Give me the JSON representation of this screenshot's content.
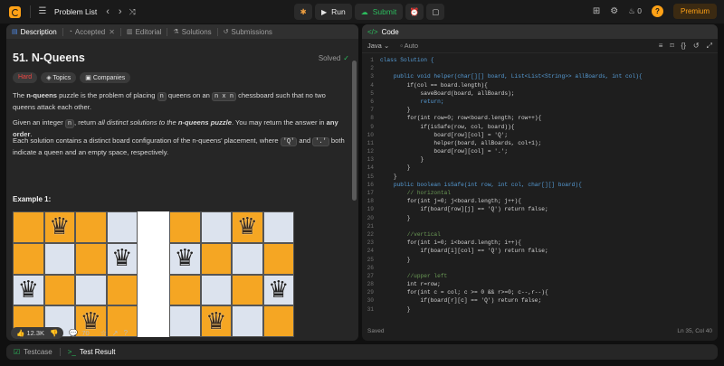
{
  "topbar": {
    "problem_list": "Problem List",
    "run": "Run",
    "submit": "Submit",
    "streak_count": "0",
    "premium": "Premium"
  },
  "left_tabs": [
    {
      "label": "Description",
      "icon": "description-icon",
      "active": true
    },
    {
      "label": "Accepted",
      "icon": "clock-icon",
      "active": false
    },
    {
      "label": "Editorial",
      "icon": "book-icon",
      "active": false
    },
    {
      "label": "Solutions",
      "icon": "flask-icon",
      "active": false
    },
    {
      "label": "Submissions",
      "icon": "history-icon",
      "active": false
    }
  ],
  "problem": {
    "title": "51. N-Queens",
    "status": "Solved",
    "difficulty": "Hard",
    "topics_label": "Topics",
    "companies_label": "Companies",
    "p1_a": "The ",
    "p1_b": "n-queens",
    "p1_c": " puzzle is the problem of placing ",
    "p1_d": "n",
    "p1_e": " queens on an ",
    "p1_f": "n x n",
    "p1_g": " chessboard such that no two queens attack each other.",
    "p2_a": "Given an integer ",
    "p2_b": "n",
    "p2_c": ", return ",
    "p2_d": "all distinct solutions to the ",
    "p2_e": "n-queens puzzle",
    "p2_f": ". You may return the answer in ",
    "p2_g": "any order",
    "p2_h": ".",
    "p3_a": "Each solution contains a distinct board configuration of the n-queens' placement, where ",
    "p3_b": "'Q'",
    "p3_c": " and ",
    "p3_d": "'.'",
    "p3_e": " both indicate a queen and an empty space, respectively.",
    "example_title": "Example 1:"
  },
  "boards": [
    {
      "colors": [
        "o",
        "o",
        "o",
        "b",
        "o",
        "b",
        "o",
        "b",
        "b",
        "o",
        "b",
        "o",
        "o",
        "b",
        "o",
        "o"
      ],
      "queens": [
        1,
        7,
        8,
        14
      ]
    },
    {
      "colors": [
        "o",
        "b",
        "o",
        "b",
        "b",
        "o",
        "b",
        "o",
        "o",
        "b",
        "o",
        "b",
        "b",
        "o",
        "b",
        "o"
      ],
      "queens": [
        2,
        4,
        11,
        13
      ]
    }
  ],
  "bottom_bar": {
    "likes": "12.3K",
    "comments": "70"
  },
  "code_panel": {
    "title": "Code",
    "language": "Java",
    "autocomplete": "Auto",
    "status": "Saved",
    "cursor": "Ln 35, Col 40"
  },
  "code_lines": [
    {
      "n": "1",
      "t": "class Solution {",
      "c": "kw"
    },
    {
      "n": "2",
      "t": "",
      "c": ""
    },
    {
      "n": "3",
      "t": "    public void helper(char[][] board, List<List<String>> allBoards, int col){",
      "c": "kw"
    },
    {
      "n": "4",
      "t": "        if(col == board.length){",
      "c": ""
    },
    {
      "n": "5",
      "t": "            saveBoard(board, allBoards);",
      "c": ""
    },
    {
      "n": "6",
      "t": "            return;",
      "c": "kw"
    },
    {
      "n": "7",
      "t": "        }",
      "c": ""
    },
    {
      "n": "8",
      "t": "        for(int row=0; row<board.length; row++){",
      "c": ""
    },
    {
      "n": "9",
      "t": "            if(isSafe(row, col, board)){",
      "c": ""
    },
    {
      "n": "10",
      "t": "                board[row][col] = 'Q';",
      "c": ""
    },
    {
      "n": "11",
      "t": "                helper(board, allBoards, col+1);",
      "c": ""
    },
    {
      "n": "12",
      "t": "                board[row][col] = '.';",
      "c": ""
    },
    {
      "n": "13",
      "t": "            }",
      "c": ""
    },
    {
      "n": "14",
      "t": "        }",
      "c": ""
    },
    {
      "n": "15",
      "t": "    }",
      "c": ""
    },
    {
      "n": "16",
      "t": "    public boolean isSafe(int row, int col, char[][] board){",
      "c": "kw"
    },
    {
      "n": "17",
      "t": "        // horizontal",
      "c": "cm"
    },
    {
      "n": "18",
      "t": "        for(int j=0; j<board.length; j++){",
      "c": ""
    },
    {
      "n": "19",
      "t": "            if(board[row][j] == 'Q') return false;",
      "c": ""
    },
    {
      "n": "20",
      "t": "        }",
      "c": ""
    },
    {
      "n": "21",
      "t": "",
      "c": ""
    },
    {
      "n": "22",
      "t": "        //vertical",
      "c": "cm"
    },
    {
      "n": "23",
      "t": "        for(int i=0; i<board.length; i++){",
      "c": ""
    },
    {
      "n": "24",
      "t": "            if(board[i][col] == 'Q') return false;",
      "c": ""
    },
    {
      "n": "25",
      "t": "        }",
      "c": ""
    },
    {
      "n": "26",
      "t": "",
      "c": ""
    },
    {
      "n": "27",
      "t": "        //upper left",
      "c": "cm"
    },
    {
      "n": "28",
      "t": "        int r=row;",
      "c": ""
    },
    {
      "n": "29",
      "t": "        for(int c = col; c >= 0 && r>=0; c--,r--){",
      "c": ""
    },
    {
      "n": "30",
      "t": "            if(board[r][c] == 'Q') return false;",
      "c": ""
    },
    {
      "n": "31",
      "t": "        }",
      "c": ""
    }
  ],
  "console": {
    "testcase": "Testcase",
    "test_result": "Test Result"
  },
  "colors": {
    "orange": "#f5a623",
    "blue_gray": "#dce3ee",
    "accent": "#ffa116",
    "green": "#2cbb5d",
    "hard": "#ef4743"
  }
}
